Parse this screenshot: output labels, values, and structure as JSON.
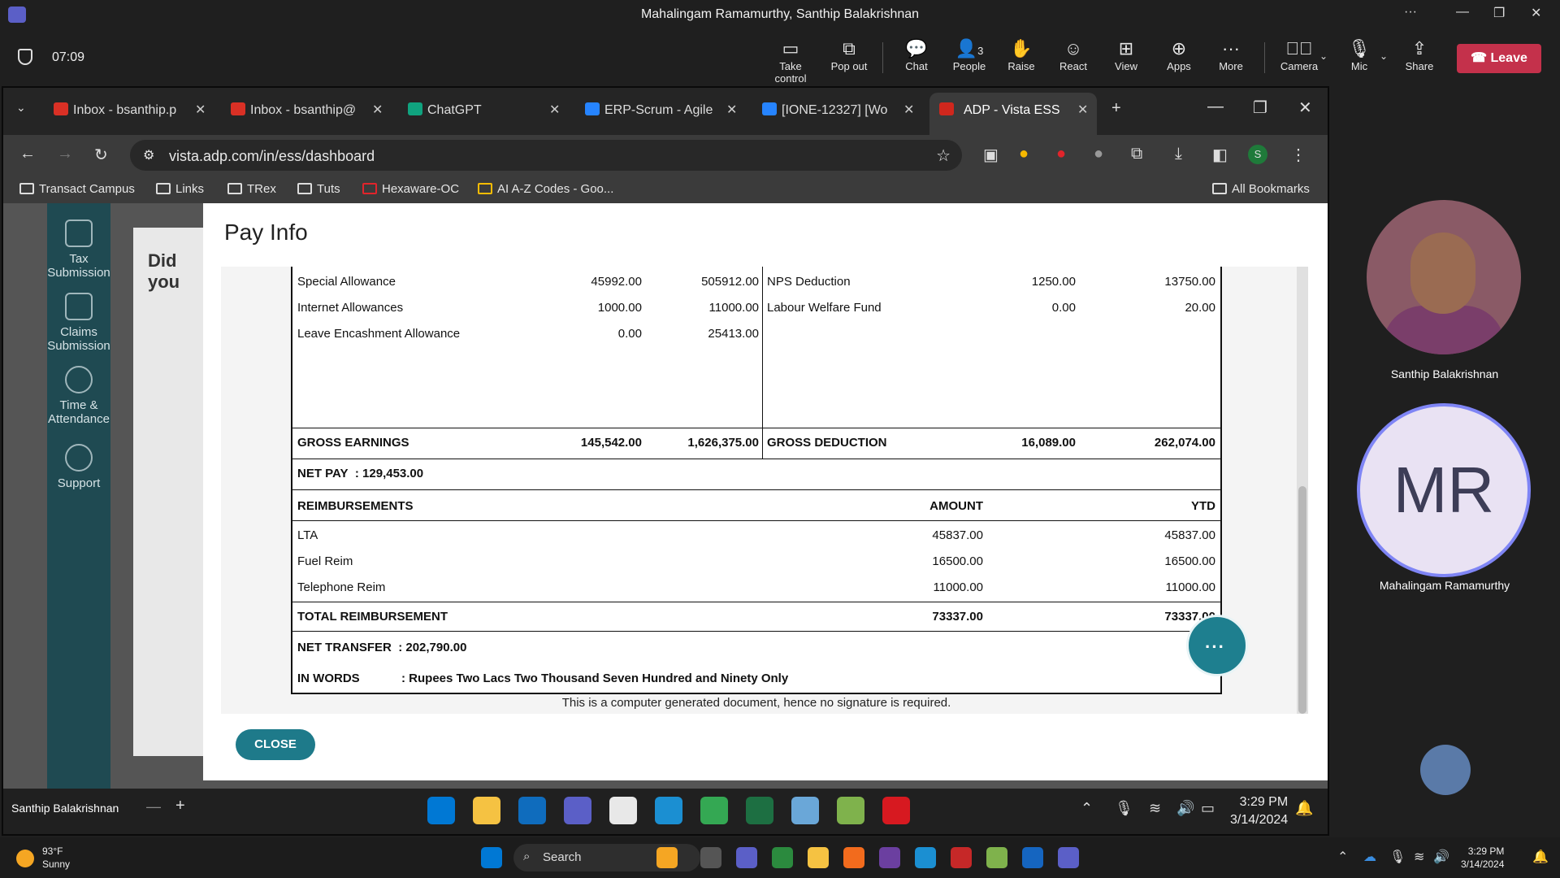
{
  "teams": {
    "window_title": "Mahalingam Ramamurthy, Santhip Balakrishnan",
    "timer": "07:09",
    "controls": [
      {
        "label": "Take control",
        "icon": "take-control-icon"
      },
      {
        "label": "Pop out",
        "icon": "pop-out-icon"
      },
      {
        "label": "Chat",
        "icon": "chat-icon"
      },
      {
        "label": "People",
        "icon": "people-icon",
        "badge": "3"
      },
      {
        "label": "Raise",
        "icon": "raise-hand-icon"
      },
      {
        "label": "React",
        "icon": "react-icon"
      },
      {
        "label": "View",
        "icon": "view-icon"
      },
      {
        "label": "Apps",
        "icon": "apps-icon"
      },
      {
        "label": "More",
        "icon": "more-icon"
      },
      {
        "label": "Camera",
        "icon": "camera-off-icon"
      },
      {
        "label": "Mic",
        "icon": "mic-icon"
      },
      {
        "label": "Share",
        "icon": "share-icon"
      }
    ],
    "leave_label": "Leave",
    "leave_color": "#c4314b",
    "presenter_name": "Santhip Balakrishnan",
    "participants": [
      {
        "name": "Santhip Balakrishnan"
      },
      {
        "name": "Mahalingam Ramamurthy",
        "initials": "MR"
      }
    ]
  },
  "browser": {
    "tabs": [
      {
        "label": "Inbox - bsanthip.p",
        "icon": "gmail-icon"
      },
      {
        "label": "Inbox - bsanthip@",
        "icon": "gmail-icon"
      },
      {
        "label": "ChatGPT",
        "icon": "chatgpt-icon"
      },
      {
        "label": "ERP-Scrum - Agile",
        "icon": "jira-icon"
      },
      {
        "label": "[IONE-12327] [Wo",
        "icon": "jira-icon"
      },
      {
        "label": "ADP - Vista ESS",
        "icon": "adp-icon",
        "active": true
      }
    ],
    "url": "vista.adp.com/in/ess/dashboard",
    "profile_initial": "S",
    "bookmarks": [
      {
        "label": "Transact Campus"
      },
      {
        "label": "Links"
      },
      {
        "label": "TRex"
      },
      {
        "label": "Tuts"
      },
      {
        "label": "Hexaware-OC"
      },
      {
        "label": "AI A-Z Codes - Goo..."
      }
    ],
    "all_bookmarks": "All Bookmarks"
  },
  "adp": {
    "sidebar": [
      {
        "label": "Tax Submission",
        "icon": "tax-submission-icon"
      },
      {
        "label": "Claims Submission",
        "icon": "claims-submission-icon"
      },
      {
        "label": "Time & Attendance",
        "icon": "time-attendance-icon"
      },
      {
        "label": "Support",
        "icon": "support-icon"
      }
    ],
    "background_heading": "Did you",
    "modal_title": "Pay Info",
    "close_label": "CLOSE",
    "earnings": [
      {
        "name": "Special Allowance",
        "amount": "45992.00",
        "ytd": "505912.00"
      },
      {
        "name": "Internet Allowances",
        "amount": "1000.00",
        "ytd": "11000.00"
      },
      {
        "name": "Leave Encashment Allowance",
        "amount": "0.00",
        "ytd": "25413.00"
      }
    ],
    "deductions": [
      {
        "name": "NPS Deduction",
        "amount": "1250.00",
        "ytd": "13750.00"
      },
      {
        "name": "Labour Welfare Fund",
        "amount": "0.00",
        "ytd": "20.00"
      }
    ],
    "gross_earnings": {
      "label": "GROSS EARNINGS",
      "amount": "145,542.00",
      "ytd": "1,626,375.00"
    },
    "gross_deduction": {
      "label": "GROSS DEDUCTION",
      "amount": "16,089.00",
      "ytd": "262,074.00"
    },
    "net_pay": {
      "label": "NET PAY",
      "value": ": 129,453.00"
    },
    "reimbursements": {
      "header": "REIMBURSEMENTS",
      "amount_header": "AMOUNT",
      "ytd_header": "YTD",
      "rows": [
        {
          "name": "LTA",
          "amount": "45837.00",
          "ytd": "45837.00"
        },
        {
          "name": "Fuel Reim",
          "amount": "16500.00",
          "ytd": "16500.00"
        },
        {
          "name": "Telephone Reim",
          "amount": "11000.00",
          "ytd": "11000.00"
        }
      ],
      "total_label": "TOTAL REIMBURSEMENT",
      "total_amount": "73337.00",
      "total_ytd": "73337.00"
    },
    "net_transfer": {
      "label": "NET TRANSFER",
      "value": ": 202,790.00"
    },
    "in_words": {
      "label": "IN WORDS",
      "value": ": Rupees Two Lacs Two Thousand Seven Hundred and Ninety Only"
    },
    "footnote": "This is a computer generated document, hence no signature is required."
  },
  "vm_taskbar": {
    "time": "3:29 PM",
    "date": "3/14/2024"
  },
  "windows": {
    "weather_temp": "93°F",
    "weather_desc": "Sunny",
    "search_placeholder": "Search",
    "time": "3:29 PM",
    "date": "3/14/2024"
  }
}
